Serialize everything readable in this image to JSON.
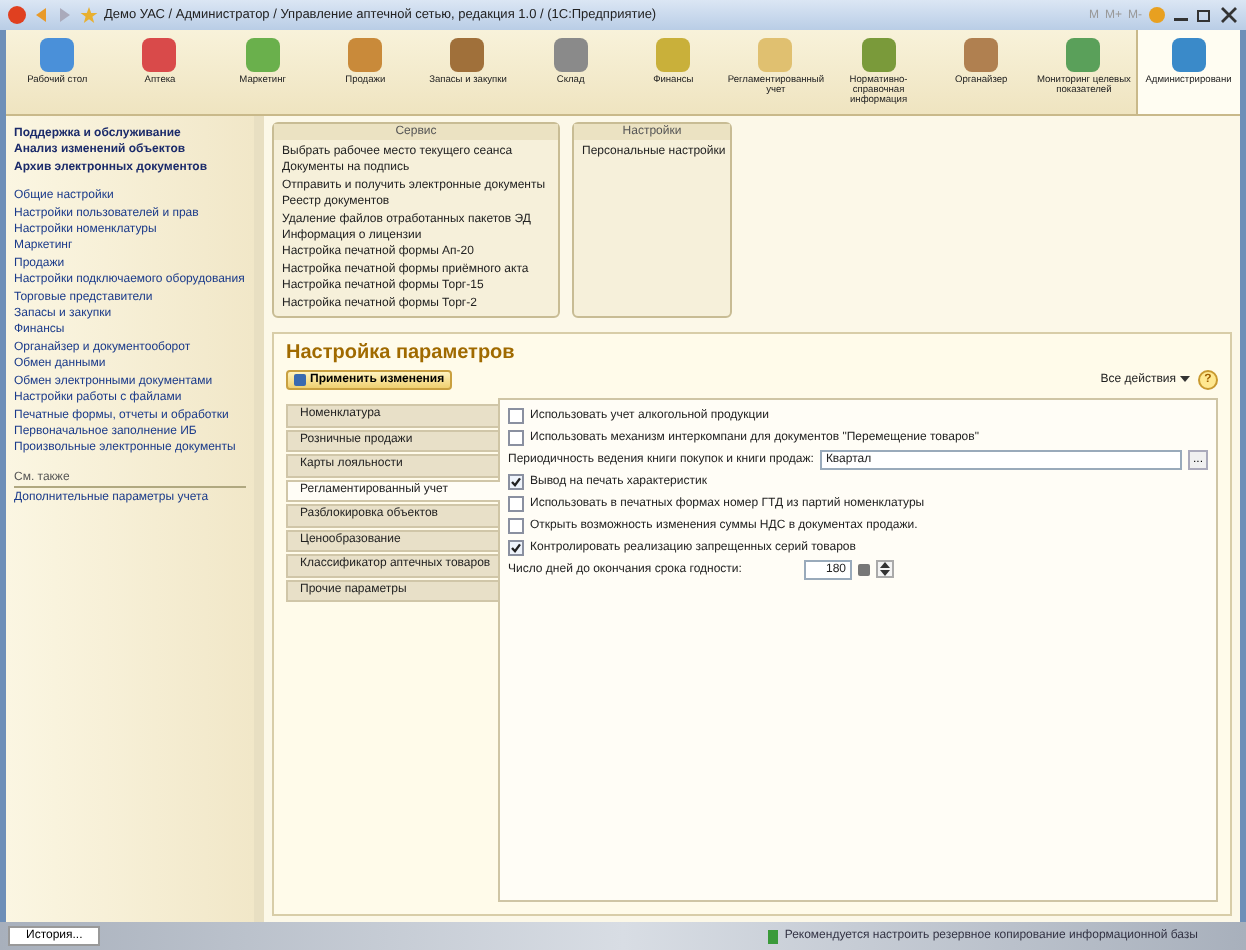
{
  "window": {
    "title": "Демо УАС / Администратор / Управление аптечной сетью, редакция 1.0 /  (1С:Предприятие)",
    "memory_buttons": [
      "M",
      "M+",
      "M-"
    ]
  },
  "sections": [
    {
      "label": "Рабочий стол",
      "color": "#4a90d9",
      "selected": false
    },
    {
      "label": "Аптека",
      "color": "#d94a4a",
      "selected": false
    },
    {
      "label": "Маркетинг",
      "color": "#6ab04c",
      "selected": false
    },
    {
      "label": "Продажи",
      "color": "#c98a3a",
      "selected": false
    },
    {
      "label": "Запасы и закупки",
      "color": "#a0703a",
      "selected": false
    },
    {
      "label": "Склад",
      "color": "#8a8a8a",
      "selected": false
    },
    {
      "label": "Финансы",
      "color": "#c9b03a",
      "selected": false
    },
    {
      "label": "Регламентированный учет",
      "color": "#e0c070",
      "selected": false
    },
    {
      "label": "Нормативно-справочная информация",
      "color": "#7a9a3a",
      "selected": false
    },
    {
      "label": "Органайзер",
      "color": "#b08050",
      "selected": false
    },
    {
      "label": "Мониторинг целевых показателей",
      "color": "#5aa05a",
      "selected": false
    },
    {
      "label": "Администрировани",
      "color": "#3a8ac9",
      "selected": true
    }
  ],
  "sidebar": {
    "bold_links": [
      "Поддержка и обслуживание",
      "Анализ изменений объектов",
      "Архив электронных документов"
    ],
    "links": [
      "Общие настройки",
      "Настройки пользователей и прав",
      "Настройки номенклатуры",
      "Маркетинг",
      "Продажи",
      "Настройки подключаемого оборудования",
      "Торговые представители",
      "Запасы и закупки",
      "Финансы",
      "Органайзер и документооборот",
      "Обмен данными",
      "Обмен электронными документами",
      "Настройки работы с файлами",
      "Печатные формы, отчеты и обработки",
      "Первоначальное заполнение ИБ",
      "Произвольные электронные документы"
    ],
    "see_also_title": "См. также",
    "see_also": [
      "Дополнительные параметры учета"
    ]
  },
  "service": {
    "title": "Сервис",
    "items": [
      "Выбрать рабочее место текущего сеанса",
      "Документы на подпись",
      "Отправить и получить электронные документы",
      "Реестр документов",
      "Удаление файлов отработанных пакетов ЭД",
      "Информация о лицензии",
      "Настройка печатной формы Ап-20",
      "Настройка печатной формы приёмного акта",
      "Настройка печатной формы Торг-15",
      "Настройка печатной формы Торг-2"
    ]
  },
  "settings": {
    "title": "Настройки",
    "items": [
      "Персональные настройки"
    ]
  },
  "form": {
    "title": "Настройка параметров",
    "apply_button": "Применить изменения",
    "all_actions": "Все действия",
    "help": "?",
    "tabs": [
      {
        "label": "Номенклатура",
        "selected": false
      },
      {
        "label": "Розничные продажи",
        "selected": false
      },
      {
        "label": "Карты лояльности",
        "selected": false
      },
      {
        "label": "Регламентированный учет",
        "selected": true
      },
      {
        "label": "Разблокировка объектов",
        "selected": false
      },
      {
        "label": "Ценообразование",
        "selected": false
      },
      {
        "label": "Классификатор аптечных товаров",
        "selected": false
      },
      {
        "label": "Прочие параметры",
        "selected": false
      }
    ],
    "options": [
      {
        "kind": "checkbox",
        "label": "Использовать учет алкогольной продукции",
        "checked": false
      },
      {
        "kind": "checkbox",
        "label": "Использовать механизм интеркомпани для документов \"Перемещение товаров\"",
        "checked": false
      },
      {
        "kind": "field",
        "label": "Периодичность ведения книги покупок и книги продаж:",
        "value": "Квартал",
        "choose_button": "..."
      },
      {
        "kind": "checkbox",
        "label": "Вывод на печать характеристик",
        "checked": true
      },
      {
        "kind": "checkbox",
        "label": "Использовать в печатных формах номер ГТД из партий номенклатуры",
        "checked": false
      },
      {
        "kind": "checkbox",
        "label": "Открыть возможность изменения суммы НДС в документах продажи.",
        "checked": false
      },
      {
        "kind": "checkbox",
        "label": "Контролировать реализацию запрещенных серий товаров",
        "checked": true
      },
      {
        "kind": "spin",
        "label": "Число дней до окончания срока годности:",
        "value": "180"
      }
    ]
  },
  "status_bar": {
    "history_button": "История...",
    "message": "Рекомендуется настроить резервное копирование информационной базы"
  }
}
